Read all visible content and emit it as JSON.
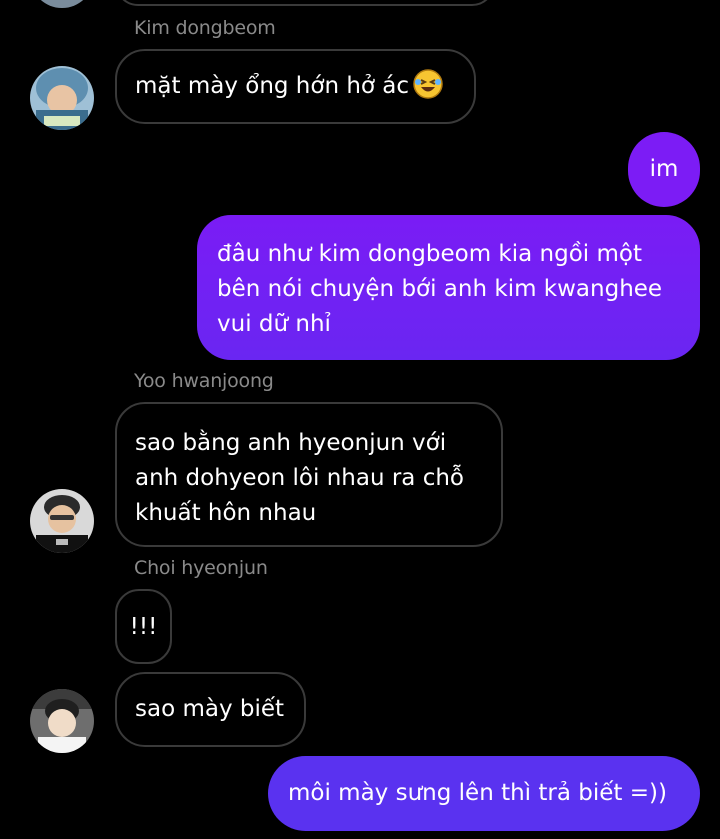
{
  "colors": {
    "background": "#000000",
    "outgoing_bubble_top": "#7a1cf5",
    "outgoing_bubble_bottom": "#5a32f0",
    "incoming_border": "#3a3a3a",
    "sender_name": "#8a8a8a"
  },
  "messages": [
    {
      "sender": "Kim dongbeom",
      "text": "mặt mày ổng hớn hở ác",
      "emoji": "rolling-on-floor-laughing-emoji"
    },
    {
      "sender": "me",
      "text": "im"
    },
    {
      "sender": "me",
      "lines": [
        "đâu như kim dongbeom kia ngồi một",
        "bên nói chuyện bới anh kim kwanghee",
        "vui dữ nhỉ"
      ]
    },
    {
      "sender": "Yoo hwanjoong",
      "lines": [
        "sao bằng anh hyeonjun với",
        "anh  dohyeon lôi nhau ra chỗ",
        "khuất hôn nhau"
      ]
    },
    {
      "sender": "Choi hyeonjun",
      "text": "!!!"
    },
    {
      "sender": "Choi hyeonjun",
      "text": "sao mày biết"
    },
    {
      "sender": "me",
      "text": "môi mày sưng lên thì trả biết =))"
    }
  ]
}
